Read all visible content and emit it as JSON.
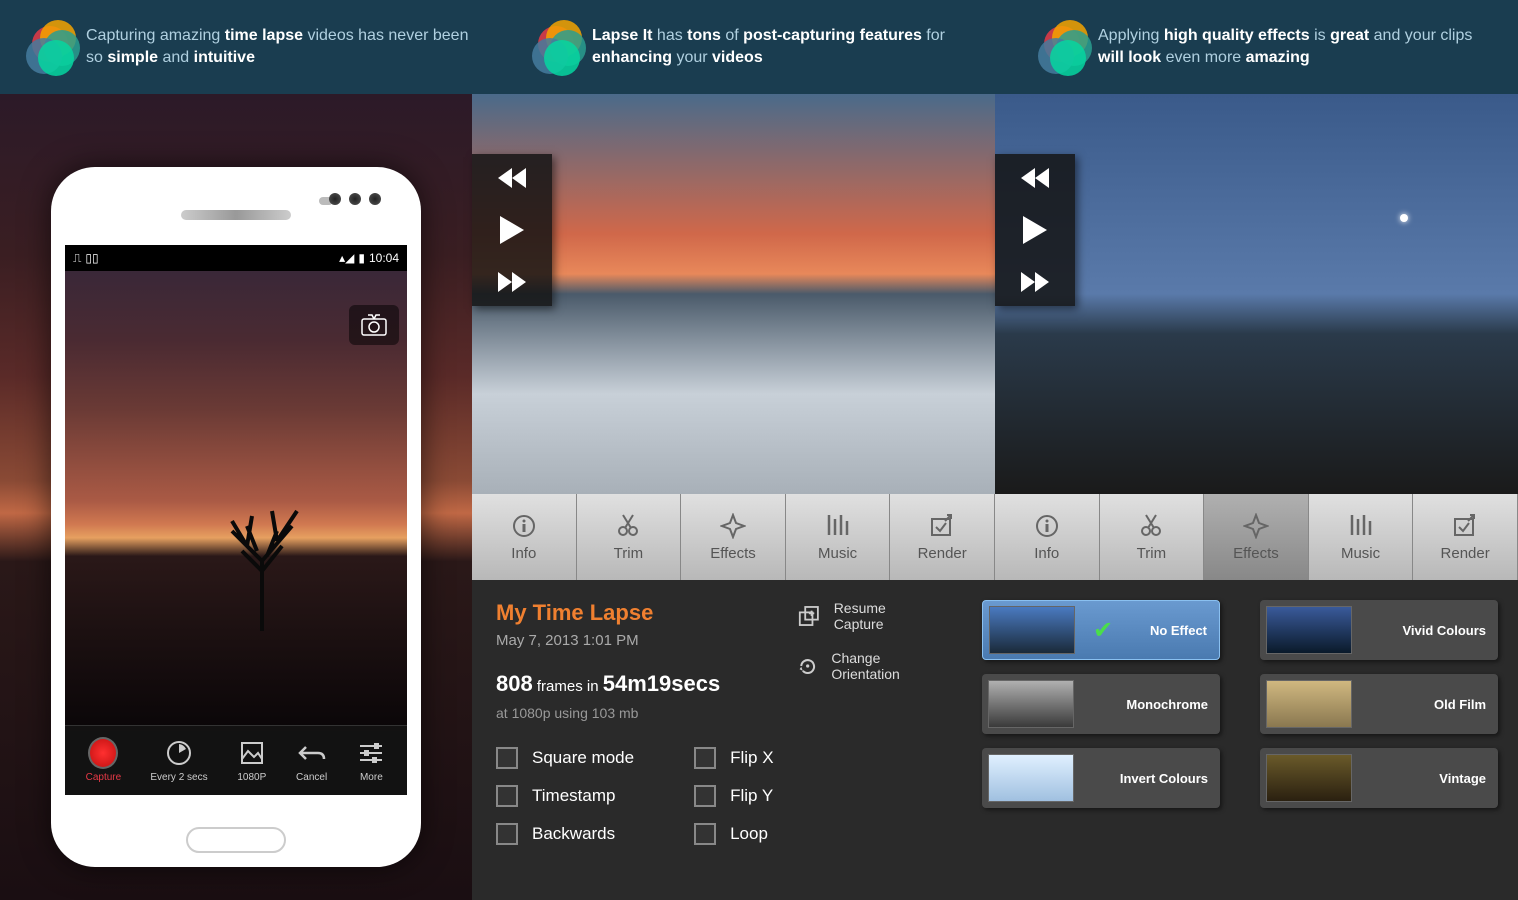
{
  "banner": [
    {
      "pre": "Capturing amazing ",
      "b1": "time lapse",
      "mid": " videos has never been so ",
      "b2": "simple",
      "and": " and ",
      "b3": "intuitive"
    },
    {
      "pre": "",
      "b1": "Lapse It",
      "mid": " has ",
      "b2": "tons",
      "mid2": " of ",
      "b3": "post-capturing features",
      "mid3": " for ",
      "b4": "enhancing",
      "mid4": " your ",
      "b5": "videos"
    },
    {
      "pre": "Applying ",
      "b1": "high quality effects",
      "mid": " is ",
      "b2": "great",
      "mid2": " and your clips ",
      "b3": "will look",
      "mid3": " even more ",
      "b4": "amazing"
    }
  ],
  "phone": {
    "time": "10:04",
    "buttons": {
      "capture": "Capture",
      "interval": "Every 2 secs",
      "resolution": "1080P",
      "cancel": "Cancel",
      "more": "More"
    }
  },
  "tabs": [
    "Info",
    "Trim",
    "Effects",
    "Music",
    "Render",
    "Info",
    "Trim",
    "Effects",
    "Music",
    "Render"
  ],
  "tab_active_index": 7,
  "project": {
    "title": "My Time Lapse",
    "date": "May 7, 2013 1:01 PM",
    "frames": "808",
    "frames_word": "frames in",
    "duration": "54m19secs",
    "resolution": "at 1080p using 103 mb"
  },
  "actions": {
    "resume": "Resume Capture",
    "orientation": "Change Orientation"
  },
  "checkboxes_left": [
    "Square mode",
    "Timestamp",
    "Backwards"
  ],
  "checkboxes_right": [
    "Flip X",
    "Flip Y",
    "Loop"
  ],
  "effects": [
    {
      "name": "No Effect",
      "selected": true,
      "bg": "linear-gradient(180deg,#4a7ac0,#1a2a3a)"
    },
    {
      "name": "Vivid Colours",
      "selected": false,
      "bg": "linear-gradient(180deg,#3a5a9a,#0a1a2a)"
    },
    {
      "name": "Monochrome",
      "selected": false,
      "bg": "linear-gradient(180deg,#b0b0b0,#3a3a3a)"
    },
    {
      "name": "Old Film",
      "selected": false,
      "bg": "linear-gradient(180deg,#d0b880,#8a7850)"
    },
    {
      "name": "Invert Colours",
      "selected": false,
      "bg": "linear-gradient(180deg,#e0f0ff,#a0c0e0)"
    },
    {
      "name": "Vintage",
      "selected": false,
      "bg": "linear-gradient(180deg,#6a5a2a,#2a2010)"
    }
  ]
}
